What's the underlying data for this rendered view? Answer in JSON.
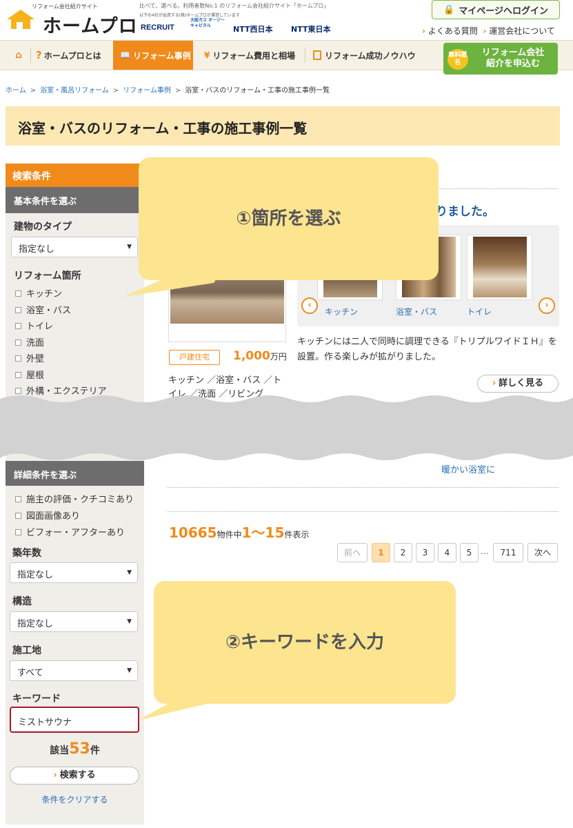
{
  "header": {
    "logo_small": "リフォーム会社紹介サイト",
    "logo_main": "ホームプロ",
    "tagline": "比べて、選べる。利用者数No.1 のリフォーム会社紹介サイト「ホームプロ」",
    "sub_tagline": "以下の4社が出資する(株)ホームプロが運営しています",
    "partners": [
      "RECRUIT",
      "大阪ガス オージーキャピタル",
      "NTT西日本",
      "NTT東日本"
    ],
    "login": "マイページへログイン",
    "faq": "よくある質問",
    "company": "運営会社について"
  },
  "nav": {
    "about": "ホームプロとは",
    "cases": "リフォーム事例",
    "cost": "リフォーム費用と相場",
    "knowhow": "リフォーム成功ノウハウ",
    "cta_badge": "無料匿名",
    "cta_line1": "リフォーム会社",
    "cta_line2": "紹介を申込む"
  },
  "breadcrumb": [
    "ホーム",
    "浴室・風呂リフォーム",
    "リフォーム事例",
    "浴室・バスのリフォーム・工事の施工事例一覧"
  ],
  "page_title": "浴室・バスのリフォーム・工事の施工事例一覧",
  "sidebar": {
    "header": "検索条件",
    "basic_header": "基本条件を選ぶ",
    "building_type_label": "建物のタイプ",
    "building_type_value": "指定なし",
    "location_label": "リフォーム箇所",
    "locations": [
      "キッチン",
      "浴室・バス",
      "トイレ",
      "洗面",
      "外壁",
      "屋根",
      "外構・エクステリア"
    ],
    "detail_header": "詳細条件を選ぶ",
    "detail_options": [
      "施主の評価・クチコミあり",
      "図面画像あり",
      "ビフォー・アフターあり"
    ],
    "age_label": "築年数",
    "age_value": "指定なし",
    "structure_label": "構造",
    "structure_value": "指定なし",
    "site_label": "施工地",
    "site_value": "すべて",
    "keyword_label": "キーワード",
    "keyword_value": "ミストサウナ",
    "count_prefix": "該当",
    "count_num": "53",
    "count_suffix": "件",
    "search_button": "検索する",
    "clear_link": "条件をクリアする"
  },
  "main": {
    "headline": "りました。",
    "tag": "戸建住宅",
    "price_num": "1,000",
    "price_unit": "万円",
    "categories_text": "キッチン ／浴室・バス ／トイレ ／洗面 ／リビング",
    "carousel_labels": [
      "キッチン",
      "浴室・バス",
      "トイレ"
    ],
    "description": "キッチンには二人で同時に調理できる『トリプルワイドＩＨ』を設置。作る楽しみが拡がりました。",
    "detail_button": "詳しく見る",
    "warm_text": "暖かい浴室に",
    "result_count": "10665",
    "result_mid": "物件中",
    "result_range": "1〜15",
    "result_suffix": "件表示",
    "pagination": {
      "prev": "前へ",
      "pages": [
        "1",
        "2",
        "3",
        "4",
        "5"
      ],
      "ellipsis": "…",
      "last": "711",
      "next": "次へ"
    }
  },
  "callouts": {
    "first": "①箇所を選ぶ",
    "second": "②キーワードを入力"
  }
}
